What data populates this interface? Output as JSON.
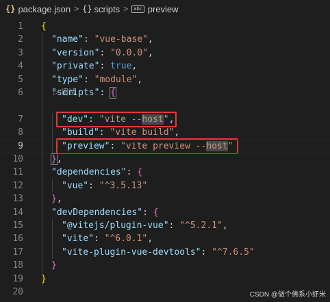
{
  "breadcrumb": {
    "file": "package.json",
    "scripts": "scripts",
    "preview": "preview",
    "file_icon": "{}",
    "object_icon": "{}",
    "string_icon": "abc",
    "separator": ">"
  },
  "codelens": {
    "label": "调试",
    "icon": "play-triangle-icon"
  },
  "lines": [
    {
      "n": "1",
      "indent": 0,
      "segs": [
        {
          "t": "{",
          "c": "b1"
        }
      ]
    },
    {
      "n": "2",
      "indent": 1,
      "segs": [
        {
          "t": "\"name\"",
          "c": "k"
        },
        {
          "t": ": ",
          "c": "p"
        },
        {
          "t": "\"vue-base\"",
          "c": "s"
        },
        {
          "t": ",",
          "c": "p"
        }
      ]
    },
    {
      "n": "3",
      "indent": 1,
      "segs": [
        {
          "t": "\"version\"",
          "c": "k"
        },
        {
          "t": ": ",
          "c": "p"
        },
        {
          "t": "\"0.0.0\"",
          "c": "s"
        },
        {
          "t": ",",
          "c": "p"
        }
      ]
    },
    {
      "n": "4",
      "indent": 1,
      "segs": [
        {
          "t": "\"private\"",
          "c": "k"
        },
        {
          "t": ": ",
          "c": "p"
        },
        {
          "t": "true",
          "c": "kw"
        },
        {
          "t": ",",
          "c": "p"
        }
      ]
    },
    {
      "n": "5",
      "indent": 1,
      "segs": [
        {
          "t": "\"type\"",
          "c": "k"
        },
        {
          "t": ": ",
          "c": "p"
        },
        {
          "t": "\"module\"",
          "c": "s"
        },
        {
          "t": ",",
          "c": "p"
        }
      ]
    },
    {
      "n": "6",
      "indent": 1,
      "segs": [
        {
          "t": "\"scripts\"",
          "c": "k"
        },
        {
          "t": ": ",
          "c": "p"
        },
        {
          "t": "{",
          "c": "b2 bracket-box"
        }
      ]
    },
    {
      "n": "7",
      "indent": 2,
      "segs": [
        {
          "t": "\"dev\"",
          "c": "k"
        },
        {
          "t": ": ",
          "c": "p"
        },
        {
          "t": "\"vite --",
          "c": "s"
        },
        {
          "t": "host",
          "c": "s hl"
        },
        {
          "t": "\"",
          "c": "s"
        },
        {
          "t": ",",
          "c": "p"
        }
      ]
    },
    {
      "n": "8",
      "indent": 2,
      "segs": [
        {
          "t": "\"build\"",
          "c": "k"
        },
        {
          "t": ": ",
          "c": "p"
        },
        {
          "t": "\"vite build\"",
          "c": "s"
        },
        {
          "t": ",",
          "c": "p"
        }
      ]
    },
    {
      "n": "9",
      "indent": 2,
      "current": true,
      "segs": [
        {
          "t": "\"preview\"",
          "c": "k"
        },
        {
          "t": ": ",
          "c": "p"
        },
        {
          "t": "\"vite preview --",
          "c": "s"
        },
        {
          "t": "host",
          "c": "s hl"
        },
        {
          "t": "\"",
          "c": "s"
        }
      ]
    },
    {
      "n": "10",
      "indent": 1,
      "segs": [
        {
          "t": "}",
          "c": "b2 bracket-box"
        },
        {
          "t": ",",
          "c": "p"
        }
      ]
    },
    {
      "n": "11",
      "indent": 1,
      "segs": [
        {
          "t": "\"dependencies\"",
          "c": "k"
        },
        {
          "t": ": ",
          "c": "p"
        },
        {
          "t": "{",
          "c": "b2"
        }
      ]
    },
    {
      "n": "12",
      "indent": 2,
      "segs": [
        {
          "t": "\"vue\"",
          "c": "k"
        },
        {
          "t": ": ",
          "c": "p"
        },
        {
          "t": "\"^3.5.13\"",
          "c": "s"
        }
      ]
    },
    {
      "n": "13",
      "indent": 1,
      "segs": [
        {
          "t": "}",
          "c": "b2"
        },
        {
          "t": ",",
          "c": "p"
        }
      ]
    },
    {
      "n": "14",
      "indent": 1,
      "segs": [
        {
          "t": "\"devDependencies\"",
          "c": "k"
        },
        {
          "t": ": ",
          "c": "p"
        },
        {
          "t": "{",
          "c": "b2"
        }
      ]
    },
    {
      "n": "15",
      "indent": 2,
      "segs": [
        {
          "t": "\"@vitejs/plugin-vue\"",
          "c": "k"
        },
        {
          "t": ": ",
          "c": "p"
        },
        {
          "t": "\"^5.2.1\"",
          "c": "s"
        },
        {
          "t": ",",
          "c": "p"
        }
      ]
    },
    {
      "n": "16",
      "indent": 2,
      "segs": [
        {
          "t": "\"vite\"",
          "c": "k"
        },
        {
          "t": ": ",
          "c": "p"
        },
        {
          "t": "\"^6.0.1\"",
          "c": "s"
        },
        {
          "t": ",",
          "c": "p"
        }
      ]
    },
    {
      "n": "17",
      "indent": 2,
      "segs": [
        {
          "t": "\"vite-plugin-vue-devtools\"",
          "c": "k"
        },
        {
          "t": ": ",
          "c": "p"
        },
        {
          "t": "\"^7.6.5\"",
          "c": "s"
        }
      ]
    },
    {
      "n": "18",
      "indent": 1,
      "segs": [
        {
          "t": "}",
          "c": "b2"
        }
      ]
    },
    {
      "n": "19",
      "indent": 0,
      "segs": [
        {
          "t": "}",
          "c": "b1"
        }
      ]
    },
    {
      "n": "20",
      "indent": 0,
      "segs": []
    }
  ],
  "watermark": "CSDN @做个佛系小虾米",
  "colors": {
    "highlight_box": "#e53935",
    "background": "#1e1e1e"
  }
}
